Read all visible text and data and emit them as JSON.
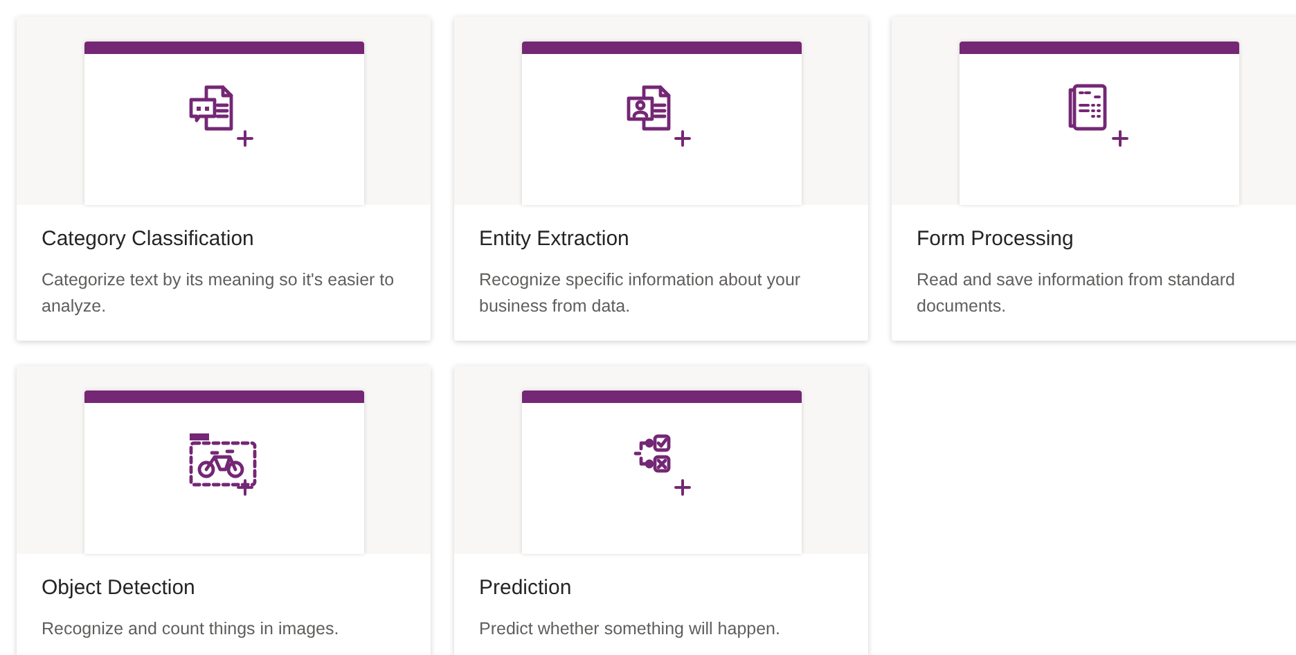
{
  "cards": [
    {
      "kind": "classification",
      "title": "Category Classification",
      "description": "Categorize text by its meaning so it's easier to analyze."
    },
    {
      "kind": "entity",
      "title": "Entity Extraction",
      "description": "Recognize specific information about your business from data."
    },
    {
      "kind": "form",
      "title": "Form Processing",
      "description": "Read and save information from standard documents."
    },
    {
      "kind": "object",
      "title": "Object Detection",
      "description": "Recognize and count things in images."
    },
    {
      "kind": "prediction",
      "title": "Prediction",
      "description": "Predict whether something will happen."
    }
  ]
}
